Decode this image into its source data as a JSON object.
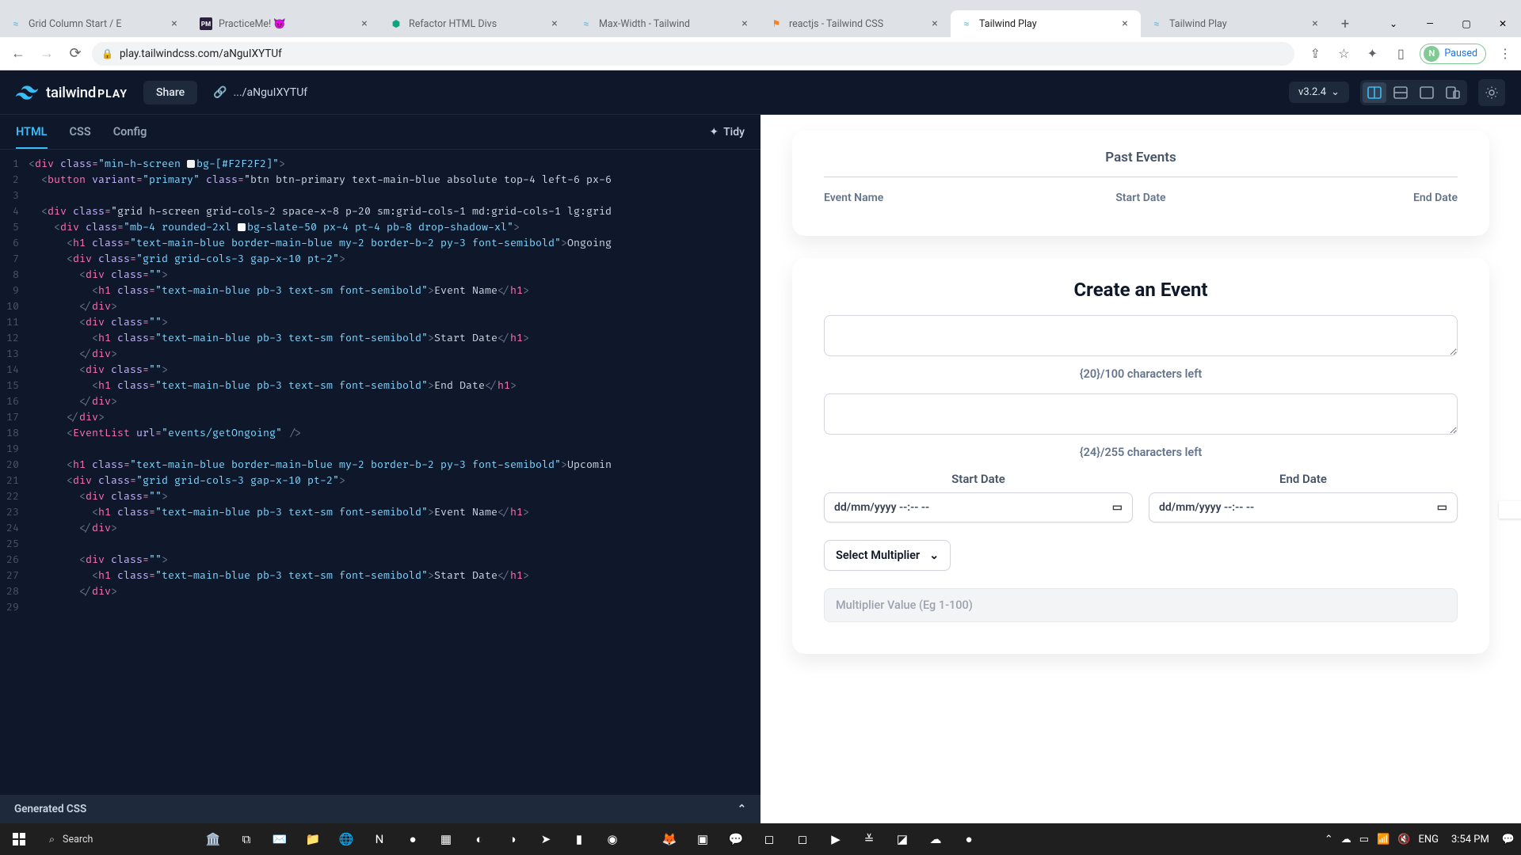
{
  "browser": {
    "tabs": [
      {
        "title": "Grid Column Start / E",
        "favicon": "tw"
      },
      {
        "title": "PracticeMe! 😈",
        "favicon": "pm"
      },
      {
        "title": "Refactor HTML Divs",
        "favicon": "so"
      },
      {
        "title": "Max-Width - Tailwind",
        "favicon": "tw"
      },
      {
        "title": "reactjs - Tailwind CSS",
        "favicon": "so2"
      },
      {
        "title": "Tailwind Play",
        "favicon": "tw",
        "active": true
      },
      {
        "title": "Tailwind Play",
        "favicon": "tw"
      }
    ],
    "url": "play.tailwindcss.com/aNguIXYTUf",
    "profile": {
      "initial": "N",
      "label": "Paused"
    }
  },
  "app": {
    "brand": "tailwind",
    "brand_suffix": "PLAY",
    "share_label": "Share",
    "url_short": ".../aNguIXYTUf",
    "version": "v3.2.4",
    "tabs": {
      "html": "HTML",
      "css": "CSS",
      "config": "Config"
    },
    "tidy_label": "Tidy",
    "gen_css_label": "Generated CSS"
  },
  "code_lines": [
    "<div class=\"min-h-screen ▢bg-[#F2F2F2]\">",
    "  <button variant=\"primary\" class=\"btn btn-primary text-main-blue absolute top-4 left-6 px-6",
    "",
    "  <div class=\"grid h-screen grid-cols-2 space-x-8 p-20 sm:grid-cols-1 md:grid-cols-1 lg:grid",
    "    <div class=\"mb-4 rounded-2xl ▢bg-slate-50 px-4 pt-4 pb-8 drop-shadow-xl\">",
    "      <h1 class=\"text-main-blue border-main-blue my-2 border-b-2 py-3 font-semibold\">Ongoing",
    "      <div class=\"grid grid-cols-3 gap-x-10 pt-2\">",
    "        <div class=\"\">",
    "          <h1 class=\"text-main-blue pb-3 text-sm font-semibold\">Event Name</h1>",
    "        </div>",
    "        <div class=\"\">",
    "          <h1 class=\"text-main-blue pb-3 text-sm font-semibold\">Start Date</h1>",
    "        </div>",
    "        <div class=\"\">",
    "          <h1 class=\"text-main-blue pb-3 text-sm font-semibold\">End Date</h1>",
    "        </div>",
    "      </div>",
    "      <EventList url=\"events/getOngoing\" />",
    "",
    "      <h1 class=\"text-main-blue border-main-blue my-2 border-b-2 py-3 font-semibold\">Upcomin",
    "      <div class=\"grid grid-cols-3 gap-x-10 pt-2\">",
    "        <div class=\"\">",
    "          <h1 class=\"text-main-blue pb-3 text-sm font-semibold\">Event Name</h1>",
    "        </div>",
    "",
    "        <div class=\"\">",
    "          <h1 class=\"text-main-blue pb-3 text-sm font-semibold\">Start Date</h1>",
    "        </div>",
    ""
  ],
  "preview": {
    "past_events_title": "Past Events",
    "headers": {
      "event_name": "Event Name",
      "start_date": "Start Date",
      "end_date": "End Date"
    },
    "create_title": "Create an Event",
    "char1": "{20}/100 characters left",
    "char2": "{24}/255 characters left",
    "start_date_label": "Start Date",
    "end_date_label": "End Date",
    "date_placeholder": "dd/mm/yyyy --:-- --",
    "select_label": "Select Multiplier",
    "mult_placeholder": "Multiplier Value (Eg 1-100)"
  },
  "taskbar": {
    "search_placeholder": "Search",
    "lang": "ENG",
    "time": "3:54 PM"
  }
}
